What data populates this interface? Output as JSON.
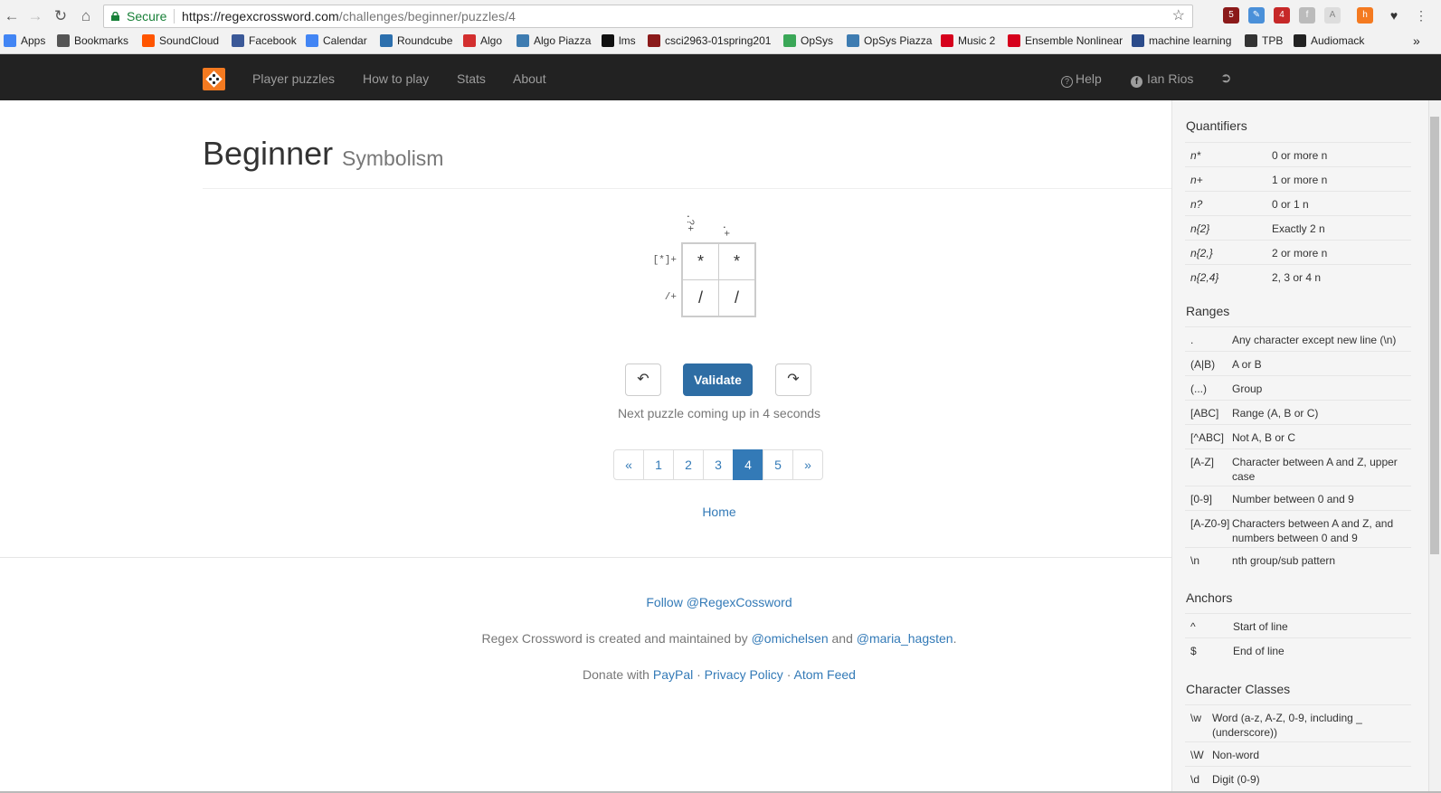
{
  "browser": {
    "secure_label": "Secure",
    "url_domain": "https://regexcrossword.com",
    "url_path": "/challenges/beginner/puzzles/4",
    "bookmarks": [
      {
        "label": "Apps",
        "icon": "apps-grid-icon",
        "color": "#4285f4"
      },
      {
        "label": "Bookmarks",
        "icon": "star-icon",
        "color": "#555555"
      },
      {
        "label": "SoundCloud",
        "icon": "soundcloud-icon",
        "color": "#ff5500"
      },
      {
        "label": "Facebook",
        "icon": "facebook-icon",
        "color": "#3b5998"
      },
      {
        "label": "Calendar",
        "icon": "calendar-icon",
        "color": "#4285f4"
      },
      {
        "label": "Roundcube",
        "icon": "roundcube-icon",
        "color": "#2c6fad"
      },
      {
        "label": "Algo",
        "icon": "cs-icon",
        "color": "#d32f2f"
      },
      {
        "label": "Algo Piazza",
        "icon": "piazza-icon",
        "color": "#3e7cb1"
      },
      {
        "label": "lms",
        "icon": "blackboard-icon",
        "color": "#111111"
      },
      {
        "label": "csci2963-01spring201",
        "icon": "hash-icon",
        "color": "#8b1a1a"
      },
      {
        "label": "OpSys",
        "icon": "opsys-icon",
        "color": "#3aa757"
      },
      {
        "label": "OpSys Piazza",
        "icon": "piazza-icon",
        "color": "#3e7cb1"
      },
      {
        "label": "Music 2",
        "icon": "rpi-icon",
        "color": "#d6001c"
      },
      {
        "label": "Ensemble Nonlinear",
        "icon": "rpi-icon",
        "color": "#d6001c"
      },
      {
        "label": "machine learning",
        "icon": "ml-icon",
        "color": "#2b4b8a"
      },
      {
        "label": "TPB",
        "icon": "pirate-ship-icon",
        "color": "#333333"
      },
      {
        "label": "Audiomack",
        "icon": "audiomack-icon",
        "color": "#222222"
      }
    ]
  },
  "navbar": {
    "links": [
      "Player puzzles",
      "How to play",
      "Stats",
      "About"
    ],
    "help": "Help",
    "user": "Ian Rios"
  },
  "page": {
    "title": "Beginner",
    "subtitle": "Symbolism"
  },
  "puzzle": {
    "col_clues": [
      ".?+",
      ".+"
    ],
    "row_clues": [
      "[*]+",
      "/+"
    ],
    "cells": [
      [
        "*",
        "*"
      ],
      [
        "/",
        "/"
      ]
    ]
  },
  "controls": {
    "validate_label": "Validate",
    "next_message": "Next puzzle coming up in 4 seconds"
  },
  "pagination": {
    "items": [
      "«",
      "1",
      "2",
      "3",
      "4",
      "5",
      "»"
    ],
    "active": "4"
  },
  "home_link": "Home",
  "footer": {
    "follow": "Follow @RegexCossword",
    "created_prefix": "Regex Crossword is created and maintained by ",
    "author1": "@omichelsen",
    "and": " and ",
    "author2": "@maria_hagsten",
    "period": ".",
    "donate_prefix": "Donate with ",
    "paypal": "PayPal",
    "sep": " · ",
    "privacy": "Privacy Policy",
    "atom": "Atom Feed"
  },
  "sidebar": {
    "quantifiers": {
      "heading": "Quantifiers",
      "rows": [
        [
          "n*",
          "0 or more n"
        ],
        [
          "n+",
          "1 or more n"
        ],
        [
          "n?",
          "0 or 1 n"
        ],
        [
          "n{2}",
          "Exactly 2 n"
        ],
        [
          "n{2,}",
          "2 or more n"
        ],
        [
          "n{2,4}",
          "2, 3 or 4 n"
        ]
      ]
    },
    "ranges": {
      "heading": "Ranges",
      "rows": [
        [
          ".",
          "Any character except new line (\\n)"
        ],
        [
          "(A|B)",
          "A or B"
        ],
        [
          "(...)",
          "Group"
        ],
        [
          "[ABC]",
          "Range (A, B or C)"
        ],
        [
          "[^ABC]",
          "Not A, B or C"
        ],
        [
          "[A-Z]",
          "Character between A and Z, upper case"
        ],
        [
          "[0-9]",
          "Number between 0 and 9"
        ],
        [
          "[A-Z0-9]",
          "Characters between A and Z, and numbers between 0 and 9"
        ],
        [
          "\\n",
          "nth group/sub pattern"
        ]
      ]
    },
    "anchors": {
      "heading": "Anchors",
      "rows": [
        [
          "^",
          "Start of line"
        ],
        [
          "$",
          "End of line"
        ]
      ]
    },
    "classes": {
      "heading": "Character Classes",
      "rows": [
        [
          "\\w",
          "Word (a-z, A-Z, 0-9, including _ (underscore))"
        ],
        [
          "\\W",
          "Non-word"
        ],
        [
          "\\d",
          "Digit (0-9)"
        ]
      ]
    }
  }
}
